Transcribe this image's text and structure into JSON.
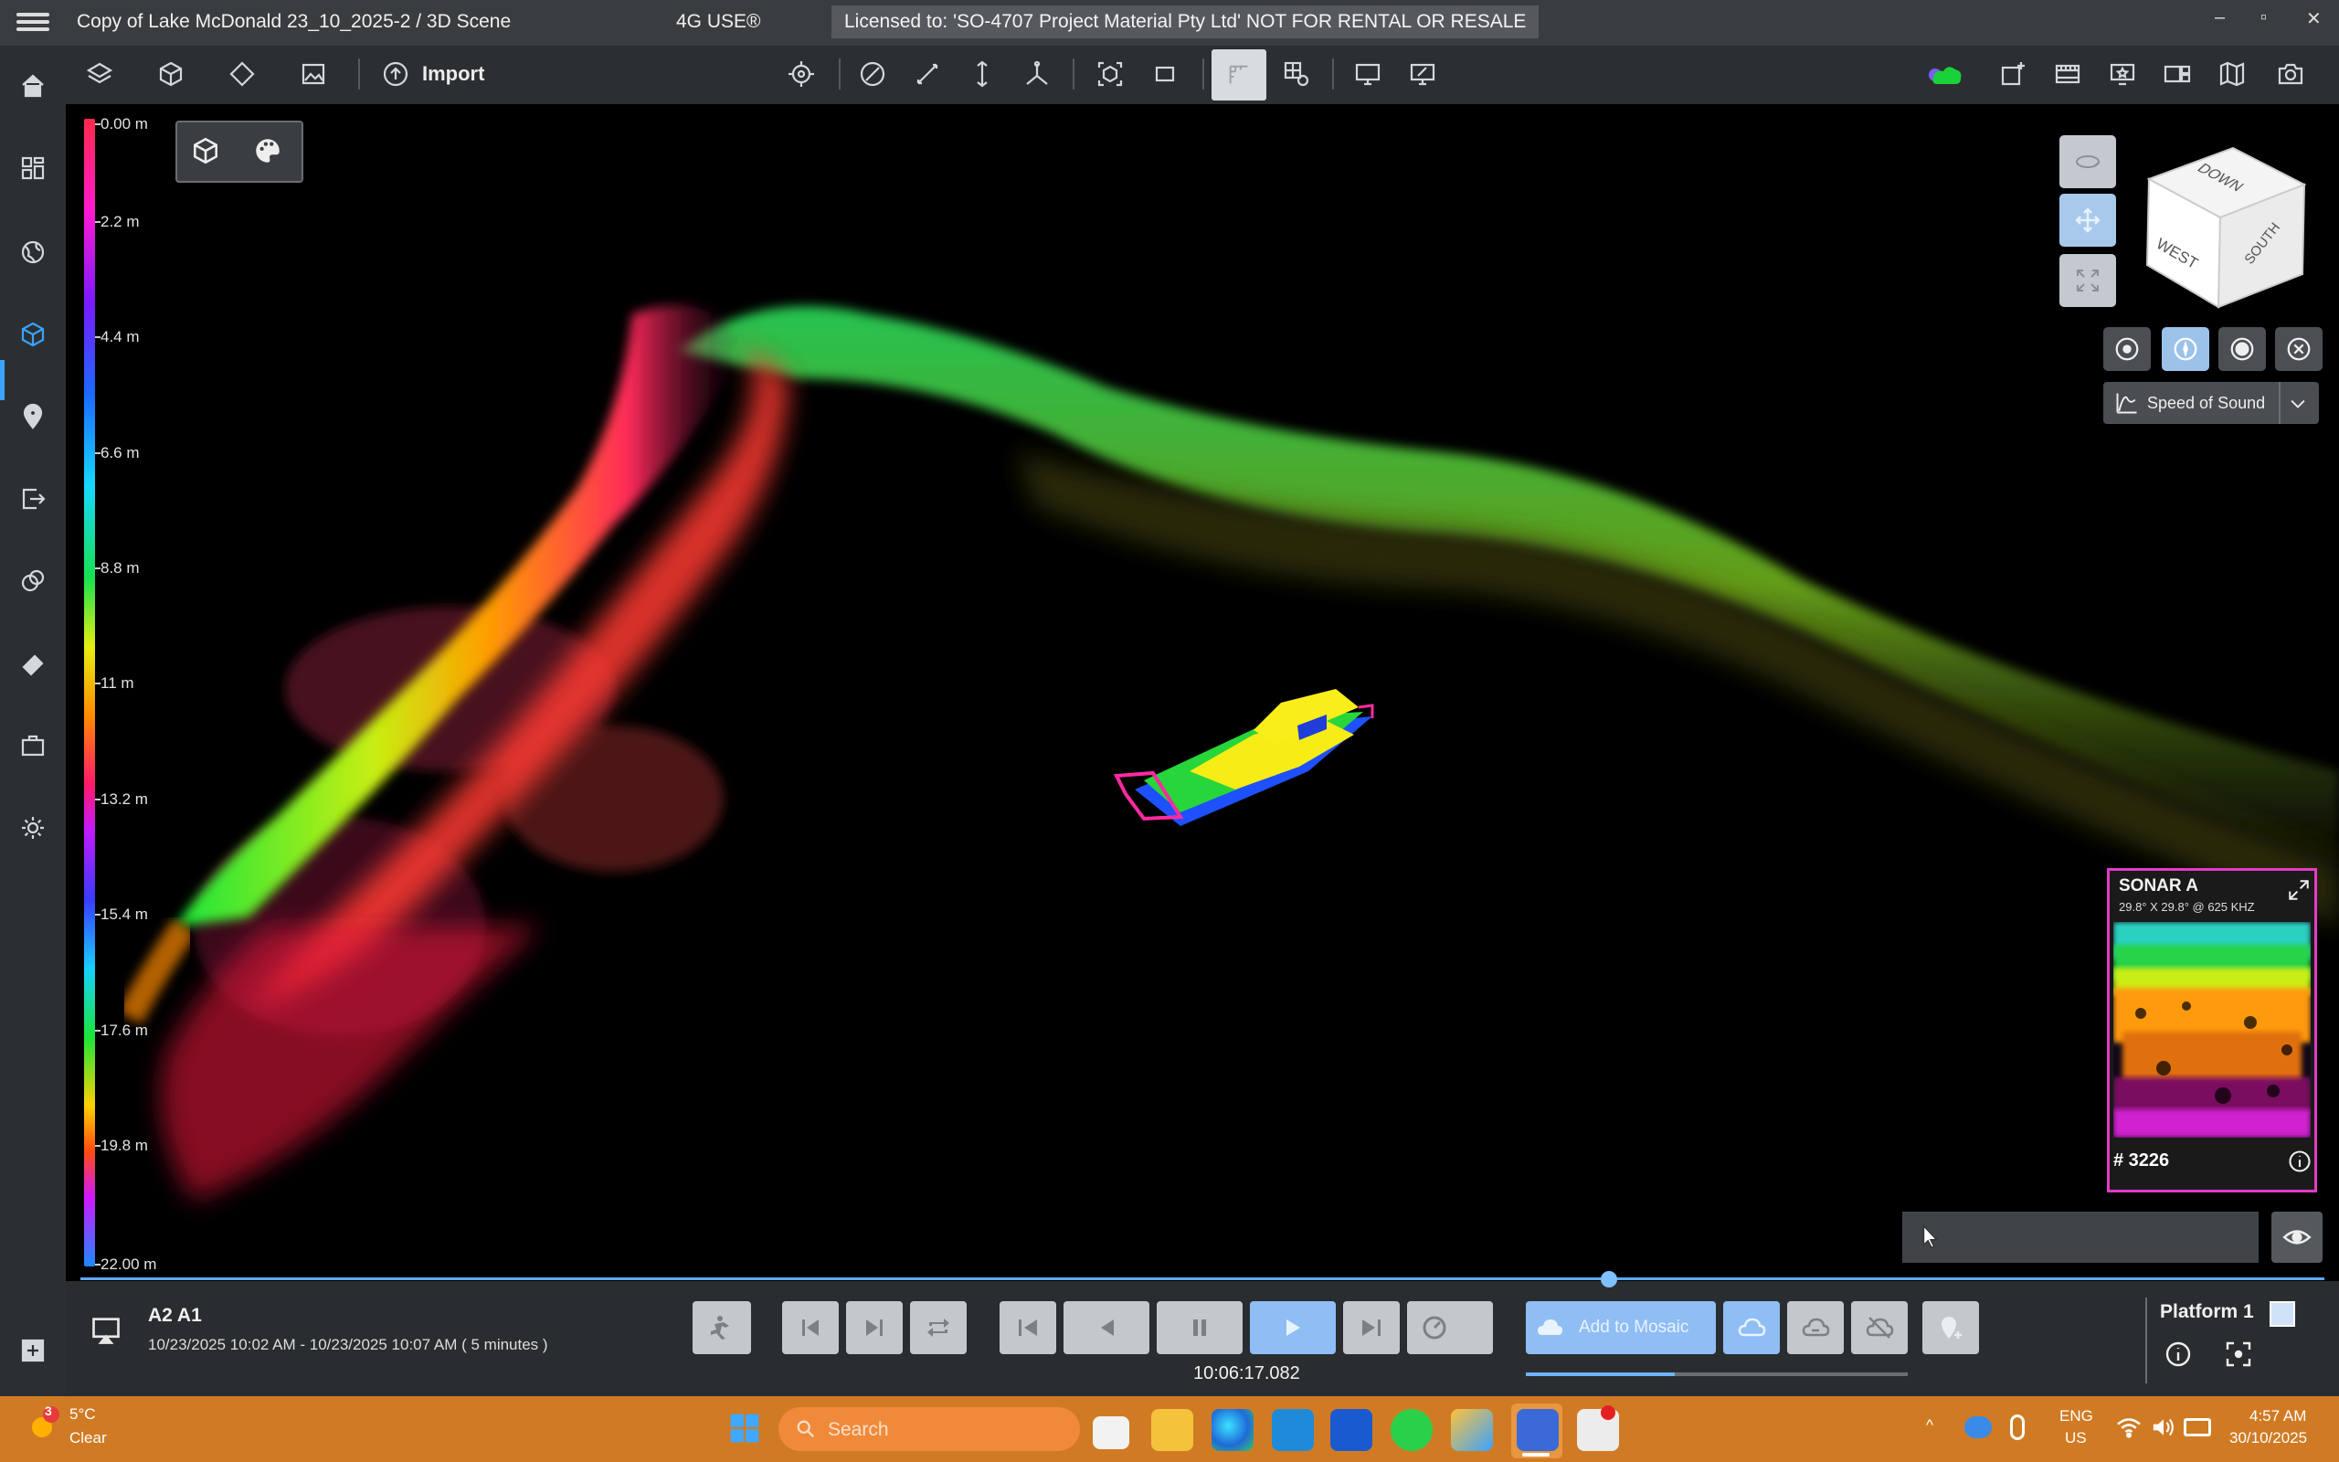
{
  "window": {
    "title": "Copy of Lake McDonald 23_10_2025-2  / 3D Scene",
    "app_badge": "4G USE®",
    "license": "Licensed to: 'SO-4707 Project Material Pty Ltd' NOT FOR RENTAL OR RESALE",
    "controls": [
      "–",
      "▫",
      "✕"
    ]
  },
  "toolbar": {
    "import_label": "Import",
    "icons": [
      "layers-icon",
      "cube-icon",
      "diamond-icon",
      "image-icon",
      "import-icon",
      "crosshair-icon",
      "angle-icon",
      "measure-line-icon",
      "height-icon",
      "triangle-measure-icon",
      "box-select-icon",
      "rectangle-icon",
      "grid-toggle-icon",
      "grid-settings-icon",
      "monitor-icon",
      "monitor-edit-icon",
      "cloud-status-icon",
      "add-frame-icon",
      "film-icon",
      "presentation-icon",
      "gallery-icon",
      "map-icon",
      "camera-icon"
    ]
  },
  "sidebar": {
    "items": [
      "home-icon",
      "dashboard-icon",
      "globe-icon",
      "scene-3d-icon",
      "location-pin-icon",
      "export-icon",
      "overlap-icon",
      "eraser-icon",
      "briefcase-icon",
      "settings-icon",
      "add-panel-icon"
    ]
  },
  "depth_scale": {
    "labels": [
      "0.00 m",
      "2.2 m",
      "4.4 m",
      "6.6 m",
      "8.8 m",
      "11 m",
      "13.2 m",
      "15.4 m",
      "17.6 m",
      "19.8 m",
      "22.00 m"
    ]
  },
  "viewcube": {
    "face_top": "DOWN",
    "face_front": "WEST",
    "face_side": "SOUTH"
  },
  "speed_of_sound": {
    "label": "Speed of Sound"
  },
  "sonar_panel": {
    "title": "SONAR A",
    "subtitle": "29.8° X 29.8° @ 625 KHZ",
    "ping": "# 3226"
  },
  "session": {
    "name": "A2 A1",
    "range": "10/23/2025 10:02 AM - 10/23/2025 10:07 AM ( 5 minutes )",
    "time": "10:06:17.082",
    "timeline_position": 0.681,
    "upload_progress": 0.39
  },
  "cloud": {
    "add_mosaic_label": "Add to Mosaic"
  },
  "platform": {
    "label": "Platform 1"
  },
  "taskbar": {
    "weather_temp": "5°C",
    "weather_desc": "Clear",
    "weather_badge": "3",
    "search_placeholder": "Search",
    "lang": "ENG",
    "region": "US",
    "time": "4:57 AM",
    "date": "30/10/2025"
  },
  "colors": {
    "accent": "#3aa3ff",
    "sonar_border": "#e53bc8",
    "taskbar": "#d07b24"
  }
}
